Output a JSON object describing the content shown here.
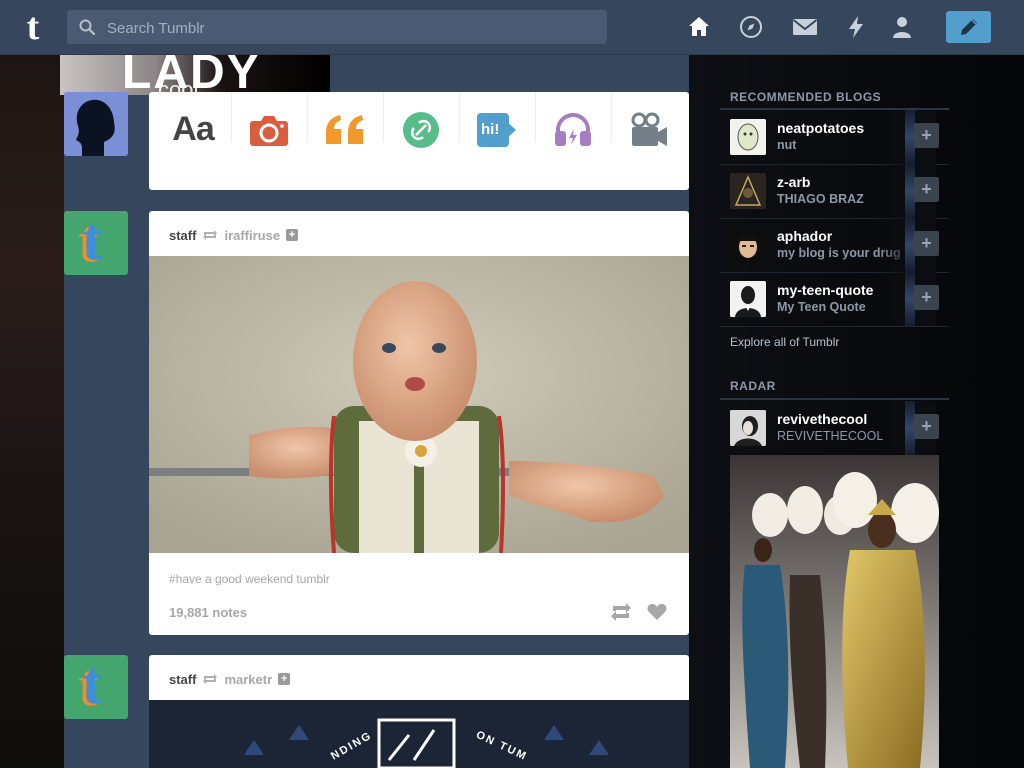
{
  "header": {
    "search_placeholder": "Search Tumblr",
    "logo_text": "t",
    "nav": [
      "home-icon",
      "explore-icon",
      "inbox-icon",
      "activity-icon",
      "account-icon"
    ],
    "compose": "compose-icon",
    "accent": "#529ecc"
  },
  "banner": {
    "line1": "LADY",
    "line2": "cool"
  },
  "composer": {
    "types": [
      {
        "name": "text",
        "label": "Aa",
        "color": "#444444"
      },
      {
        "name": "photo",
        "label": "",
        "color": "#d95e40"
      },
      {
        "name": "quote",
        "label": "“",
        "color": "#f2992e"
      },
      {
        "name": "link",
        "label": "",
        "color": "#56bc8a"
      },
      {
        "name": "chat",
        "label": "hi!",
        "color": "#529ecc"
      },
      {
        "name": "audio",
        "label": "",
        "color": "#a77dc2"
      },
      {
        "name": "video",
        "label": "",
        "color": "#748089"
      }
    ]
  },
  "posts": [
    {
      "author": "staff",
      "reblogged_from": "iraffiruse",
      "tags": "#have a good weekend tumblr",
      "notes": "19,881 notes"
    },
    {
      "author": "staff",
      "reblogged_from": "marketr",
      "banner_words": [
        "NDING",
        "ON TUM"
      ]
    }
  ],
  "sidebar": {
    "recommended_title": "RECOMMENDED BLOGS",
    "blogs": [
      {
        "name": "neatpotatoes",
        "title": "nut"
      },
      {
        "name": "z-arb",
        "title": "THIAGO BRAZ"
      },
      {
        "name": "aphador",
        "title": "my blog is your drug"
      },
      {
        "name": "my-teen-quote",
        "title": "My Teen Quote"
      }
    ],
    "explore_label": "Explore all of Tumblr",
    "radar_title": "RADAR",
    "radar_blog": {
      "name": "revivethecool",
      "title": "REVIVETHECOOL"
    },
    "follow_label": "+"
  }
}
